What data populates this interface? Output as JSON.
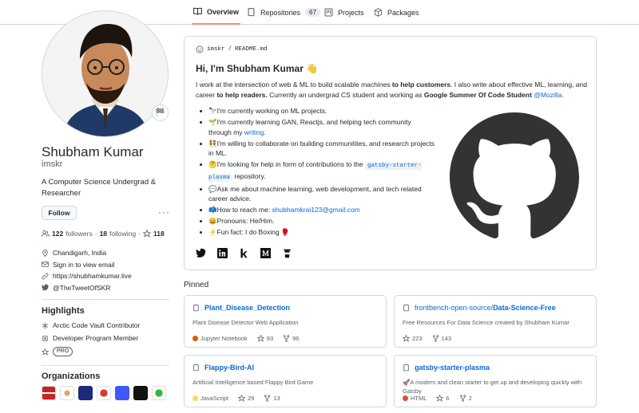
{
  "tabs": [
    {
      "label": "Overview"
    },
    {
      "label": "Repositories",
      "count": "67"
    },
    {
      "label": "Projects"
    },
    {
      "label": "Packages"
    }
  ],
  "profile": {
    "status_emoji": "🏁",
    "name": "Shubham Kumar",
    "login": "imskr",
    "bio": "A Computer Science Undergrad & Researcher",
    "follow_label": "Follow",
    "more_label": "···"
  },
  "stats": {
    "followers": "122",
    "followers_label": "followers",
    "dot": "·",
    "following": "18",
    "following_label": "following",
    "stars": "118"
  },
  "vcard": {
    "location": "Chandigarh, India",
    "email": "Sign in to view email",
    "url": "https://shubhamkumar.live",
    "twitter": "@TheTweetOfSKR"
  },
  "highlights": {
    "title": "Highlights",
    "items": [
      "Arctic Code Vault Contributor",
      "Developer Program Member"
    ],
    "pro": "PRO"
  },
  "organizations": {
    "title": "Organizations"
  },
  "readme": {
    "user": "imskr",
    "slash": "/",
    "file": "README.md",
    "title": "Hi, I'm Shubham Kumar 👋",
    "intro_1": "I work at the intersection of web & ML to build scalable machines ",
    "intro_b1": "to help customers",
    "intro_2": ". I also write about effective ML, learning, and career ",
    "intro_b2": "to help readers.",
    "intro_3": " Currently an undergrad CS student and working as ",
    "intro_b3": "Google Summer Of Code Student",
    "intro_link": "@Mozilla",
    "intro_end": ".",
    "b1": "🔭I'm currently working on ML projects.",
    "b2a": "🌱I'm currently learning GAN, Reactjs, and helping tech community through my ",
    "b2link": "writing",
    "b2b": ".",
    "b3": "👯I'm willing to collaborate on building communitites, and research projects in ML.",
    "b4a": "🤔I'm looking for help in form of contributions to the ",
    "b4code": "gatsby-starter-plasma",
    "b4b": " repository.",
    "b5": "💬Ask me about machine learning, web development, and tech related career advice.",
    "b6a": "📫How to reach me: ",
    "b6link": "shubhamkrai123@gmail.com",
    "b7": "😄Pronouns: He/Him.",
    "b8": "⚡Fun fact: I do Boxing 🥊"
  },
  "pinned": {
    "title": "Pinned",
    "cards": [
      {
        "owner": "",
        "name": "Plant_Disease_Detection",
        "desc": "Plant Disease Detector Web Application",
        "lang": "Jupyter Notebook",
        "lang_color": "#DA5B0B",
        "stars": "93",
        "forks": "96"
      },
      {
        "owner": "frontbench-open-source/",
        "name": "Data-Science-Free",
        "desc": "Free Resources For Data Science created by Shubham Kumar",
        "lang": "",
        "lang_color": "",
        "stars": "223",
        "forks": "143"
      },
      {
        "owner": "",
        "name": "Flappy-Bird-AI",
        "desc": "Artificial Intelligence based Flappy Bird Game",
        "lang": "JavaScript",
        "lang_color": "#f1e05a",
        "stars": "29",
        "forks": "13"
      },
      {
        "owner": "",
        "name": "gatsby-starter-plasma",
        "desc": "🚀A modern and clean starter to get up and developing quickly with Gatsby",
        "lang": "HTML",
        "lang_color": "#e34c26",
        "stars": "6",
        "forks": "2"
      }
    ]
  }
}
